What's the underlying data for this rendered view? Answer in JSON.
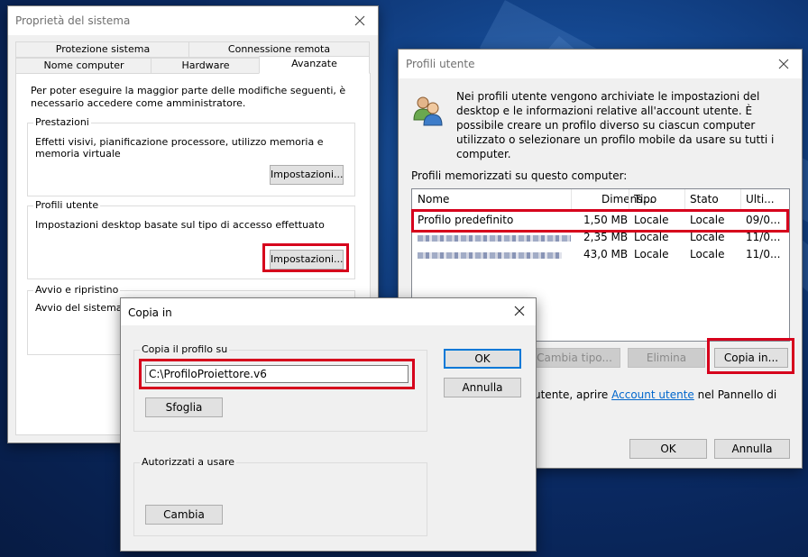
{
  "system_properties": {
    "title": "Proprietà del sistema",
    "tabs_row1": [
      "Protezione sistema",
      "Connessione remota"
    ],
    "tabs_row2": [
      "Nome computer",
      "Hardware",
      "Avanzate"
    ],
    "intro": "Per poter eseguire la maggior parte delle modifiche seguenti, è necessario accedere come amministratore.",
    "performance": {
      "label": "Prestazioni",
      "text": "Effetti visivi, pianificazione processore, utilizzo memoria e memoria virtuale",
      "button": "Impostazioni..."
    },
    "user_profiles": {
      "label": "Profili utente",
      "text": "Impostazioni desktop basate sul tipo di accesso effettuato",
      "button": "Impostazioni..."
    },
    "startup": {
      "label": "Avvio e ripristino",
      "text": "Avvio del sistema, e"
    }
  },
  "user_profiles_dialog": {
    "title": "Profili utente",
    "icon": "users-icon",
    "description": "Nei profili utente vengono archiviate le impostazioni del desktop e le informazioni relative all'account utente. È possibile creare un profilo diverso su ciascun computer utilizzato o selezionare un profilo mobile da usare su tutti i computer.",
    "list_label": "Profili memorizzati su questo computer:",
    "columns": [
      "Nome",
      "Dimens...",
      "Tipo",
      "Stato",
      "Ulti..."
    ],
    "rows": [
      {
        "name": "Profilo predefinito",
        "size": "1,50 MB",
        "type": "Locale",
        "status": "Locale",
        "last": "09/0..."
      },
      {
        "name": "",
        "size": "2,35 MB",
        "type": "Locale",
        "status": "Locale",
        "last": "11/0..."
      },
      {
        "name": "",
        "size": "43,0 MB",
        "type": "Locale",
        "status": "Locale",
        "last": "11/0..."
      }
    ],
    "buttons": {
      "change_type": "Cambia tipo...",
      "delete": "Elimina",
      "copy_to": "Copia in..."
    },
    "account_text_before": "utente, aprire ",
    "account_link": "Account utente",
    "account_text_after": " nel Pannello di",
    "ok": "OK",
    "cancel": "Annulla"
  },
  "copy_dialog": {
    "title": "Copia in",
    "copy_profile_label": "Copia il profilo su",
    "path_value": "C:\\ProfiloProiettore.v6",
    "browse": "Sfoglia",
    "permitted_label": "Autorizzati a usare",
    "change": "Cambia",
    "ok": "OK",
    "cancel": "Annulla"
  },
  "colors": {
    "highlight_red": "#d6001c",
    "accent_blue": "#0078d7",
    "link_blue": "#0066cc"
  }
}
